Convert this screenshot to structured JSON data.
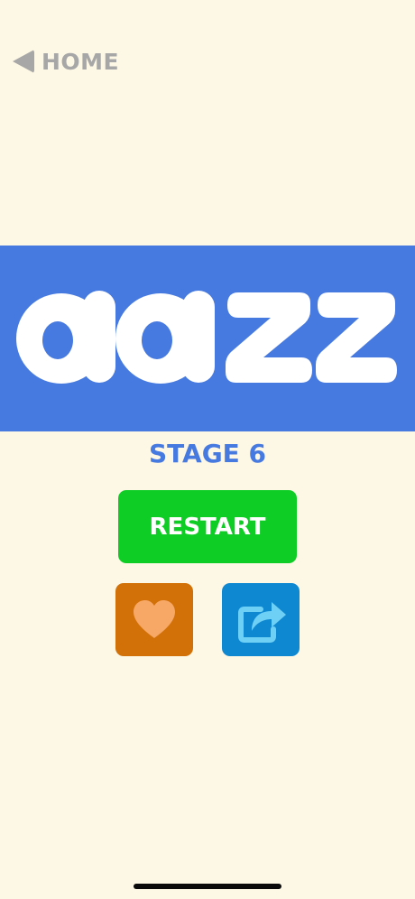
{
  "nav": {
    "home_label": "HOME"
  },
  "puzzle": {
    "letters": [
      "a",
      "a",
      "z",
      "z"
    ]
  },
  "stage": {
    "label": "STAGE 6"
  },
  "actions": {
    "restart_label": "RESTART",
    "like_icon": "heart-icon",
    "share_icon": "share-icon"
  },
  "colors": {
    "background": "#fdf7e6",
    "banner": "#477ae0",
    "restart": "#0ece25",
    "like": "#d17107",
    "like_icon": "#f7a766",
    "share": "#0f88d2",
    "share_icon": "#6fd0f6",
    "nav": "#a7a7a7"
  }
}
